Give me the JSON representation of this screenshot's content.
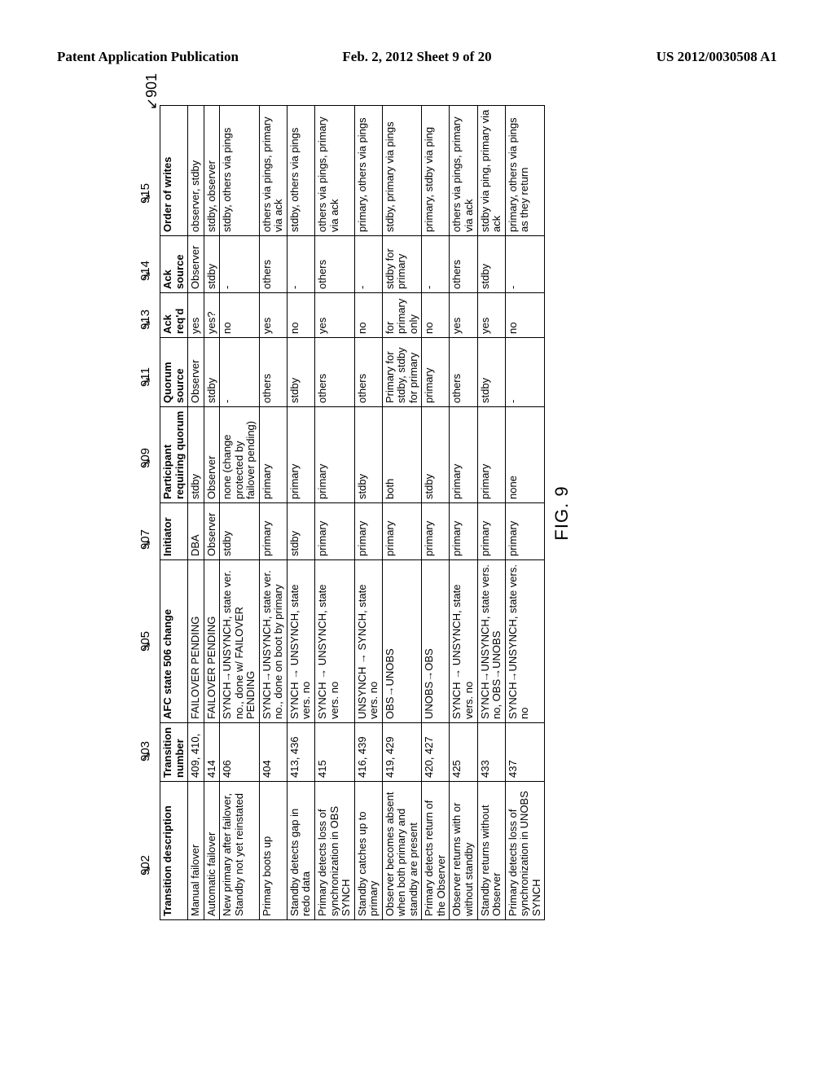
{
  "header": {
    "left": "Patent Application Publication",
    "center": "Feb. 2, 2012  Sheet 9 of 20",
    "right": "US 2012/0030508 A1"
  },
  "figure_lead": "901",
  "col_refs": {
    "desc": "902",
    "num": "903",
    "state": "905",
    "init": "907",
    "part": "909",
    "quo": "911",
    "ackr": "913",
    "acks": "914",
    "ord": "915"
  },
  "columns": [
    "Transition description",
    "Transition number",
    "AFC state 506 change",
    "Initiator",
    "Participant requiring quorum",
    "Quorum source",
    "Ack req'd",
    "Ack source",
    "Order of writes"
  ],
  "rows": [
    {
      "desc": "Manual failover",
      "num": "409, 410,",
      "state": "FAILOVER PENDING",
      "init": "DBA",
      "part": "stdby",
      "quo": "Observer",
      "ackr": "yes",
      "acks": "Observer",
      "ord": "observer, stdby"
    },
    {
      "desc": "Automatic failover",
      "num": "414",
      "state": "FAILOVER PENDING",
      "init": "Observer",
      "part": "Observer",
      "quo": "stdby",
      "ackr": "yes?",
      "acks": "stdby",
      "ord": "stdby, observer"
    },
    {
      "desc": "New primary after failover, Standby not yet reinstated",
      "num": "406",
      "state": "SYNCH→UNSYNCH, state ver. no., done w/ FAILOVER PENDING",
      "init": "stdby",
      "part": "none (change protected by failover pending)",
      "quo": "-",
      "ackr": "no",
      "acks": "-",
      "ord": "stdby, others via pings"
    },
    {
      "desc": "Primary boots up",
      "num": "404",
      "state": "SYNCH→UNSYNCH, state ver. no., done on boot by primary",
      "init": "primary",
      "part": "primary",
      "quo": "others",
      "ackr": "yes",
      "acks": "others",
      "ord": "others via pings, primary via ack"
    },
    {
      "desc": "Standby detects gap in redo data",
      "num": "413, 436",
      "state": "SYNCH → UNSYNCH, state vers. no",
      "init": "stdby",
      "part": "primary",
      "quo": "stdby",
      "ackr": "no",
      "acks": "-",
      "ord": "stdby, others via pings"
    },
    {
      "desc": "Primary detects loss of synchronization in OBS SYNCH",
      "num": "415",
      "state": "SYNCH → UNSYNCH, state vers. no",
      "init": "primary",
      "part": "primary",
      "quo": "others",
      "ackr": "yes",
      "acks": "others",
      "ord": "others via pings, primary via ack"
    },
    {
      "desc": "Standby catches up to primary",
      "num": "416, 439",
      "state": "UNSYNCH → SYNCH, state vers. no",
      "init": "primary",
      "part": "stdby",
      "quo": "others",
      "ackr": "no",
      "acks": "-",
      "ord": "primary, others via pings"
    },
    {
      "desc": "Observer becomes absent when both primary and standby are present",
      "num": "419, 429",
      "state": "OBS→UNOBS",
      "init": "primary",
      "part": "both",
      "quo": "Primary for stdby, stdby for primary",
      "ackr": "for primary only",
      "acks": "stdby for primary",
      "ord": "stdby, primary via pings"
    },
    {
      "desc": "Primary detects return of the Observer",
      "num": "420, 427",
      "state": "UNOBS→OBS",
      "init": "primary",
      "part": "stdby",
      "quo": "primary",
      "ackr": "no",
      "acks": "-",
      "ord": "primary, stdby via ping"
    },
    {
      "desc": "Observer returns with or without standby",
      "num": "425",
      "state": "SYNCH → UNSYNCH, state vers. no",
      "init": "primary",
      "part": "primary",
      "quo": "others",
      "ackr": "yes",
      "acks": "others",
      "ord": "others via pings, primary via ack"
    },
    {
      "desc": "Standby returns without Observer",
      "num": "433",
      "state": "SYNCH→UNSYNCH, state vers. no, OBS→UNOBS",
      "init": "primary",
      "part": "primary",
      "quo": "stdby",
      "ackr": "yes",
      "acks": "stdby",
      "ord": "stdby via ping, primary via ack"
    },
    {
      "desc": "Primary detects loss of synchronization in UNOBS SYNCH",
      "num": "437",
      "state": "SYNCH→UNSYNCH, state vers. no",
      "init": "primary",
      "part": "none",
      "quo": "-",
      "ackr": "no",
      "acks": "-",
      "ord": "primary, others via pings as they return"
    }
  ],
  "caption": "FIG. 9"
}
